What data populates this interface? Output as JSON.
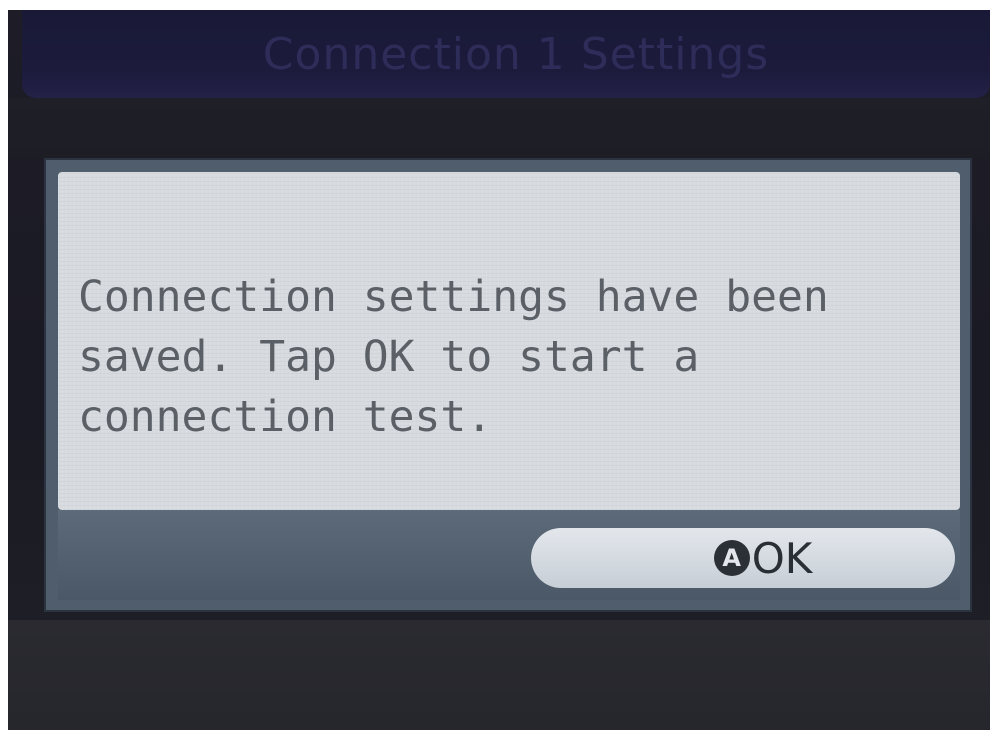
{
  "screen": {
    "title": "Connection 1 Settings"
  },
  "dialog": {
    "message": "Connection settings have been\nsaved. Tap OK to start a\nconnection test.",
    "ok_button": {
      "icon_letter": "A",
      "icon": "a-button-icon",
      "label": "OK"
    }
  },
  "colors": {
    "panel_background": "#d7dbe0",
    "button_row_background": "#4f5d6c",
    "screen_background": "#1d1c27",
    "title_bar_background": "#1c1b3c"
  }
}
